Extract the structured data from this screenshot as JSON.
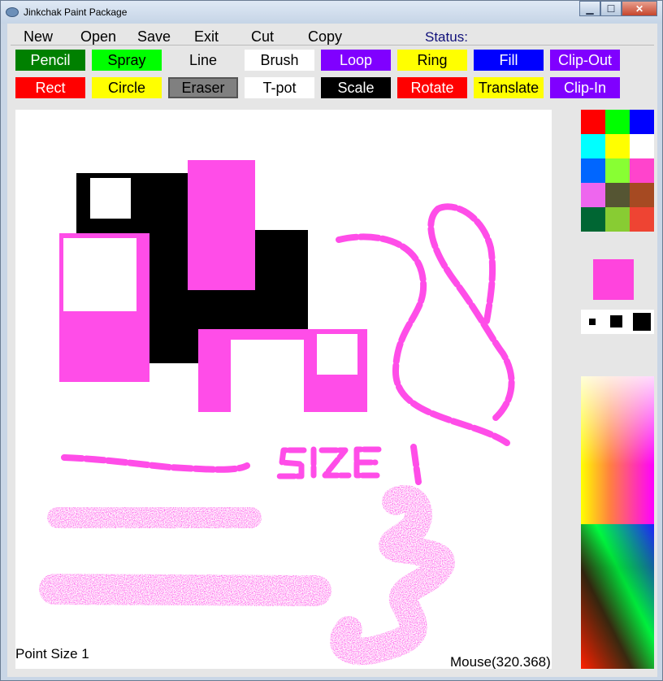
{
  "window": {
    "title": "Jinkchak Paint Package"
  },
  "menu": {
    "items": [
      "New",
      "Open",
      "Save",
      "Exit",
      "Cut",
      "Copy"
    ],
    "status_label": "Status:"
  },
  "tools_row1": [
    {
      "label": "Pencil",
      "bg": "#008000",
      "fg": "#ffffff"
    },
    {
      "label": "Spray",
      "bg": "#00ff00",
      "fg": "#000000"
    },
    {
      "label": "Line",
      "bg": "#e6e6e6",
      "fg": "#000000"
    },
    {
      "label": "Brush",
      "bg": "#ffffff",
      "fg": "#000000"
    },
    {
      "label": "Loop",
      "bg": "#8000ff",
      "fg": "#ffffff"
    },
    {
      "label": "Ring",
      "bg": "#ffff00",
      "fg": "#000000"
    },
    {
      "label": "Fill",
      "bg": "#0000ff",
      "fg": "#ffffff"
    },
    {
      "label": "Clip-Out",
      "bg": "#8000ff",
      "fg": "#ffffff"
    }
  ],
  "tools_row2": [
    {
      "label": "Rect",
      "bg": "#ff0000",
      "fg": "#ffffff"
    },
    {
      "label": "Circle",
      "bg": "#ffff00",
      "fg": "#000000"
    },
    {
      "label": "Eraser",
      "bg": "#808080",
      "fg": "#000000"
    },
    {
      "label": "T-pot",
      "bg": "#ffffff",
      "fg": "#000000"
    },
    {
      "label": "Scale",
      "bg": "#000000",
      "fg": "#ffffff"
    },
    {
      "label": "Rotate",
      "bg": "#ff0000",
      "fg": "#ffffff"
    },
    {
      "label": "Translate",
      "bg": "#ffff00",
      "fg": "#000000"
    },
    {
      "label": "Clip-In",
      "bg": "#8000ff",
      "fg": "#ffffff"
    }
  ],
  "palette": {
    "colors": [
      "#ff0000",
      "#00ff00",
      "#0000ff",
      "#00ffff",
      "#ffff00",
      "#ffffff",
      "#0066ff",
      "#88ff33",
      "#ff44cc",
      "#ee66ee",
      "#555533",
      "#a64a22",
      "#006633",
      "#88cc33",
      "#ee4433"
    ],
    "current_color": "#ff44dd",
    "point_sizes": [
      "small",
      "medium",
      "large"
    ]
  },
  "canvas": {
    "drawn_text": "SIZE 1",
    "ink_color": "#ff4de8"
  },
  "status": {
    "point_size": "Point Size 1",
    "mouse": "Mouse(320.368)"
  }
}
